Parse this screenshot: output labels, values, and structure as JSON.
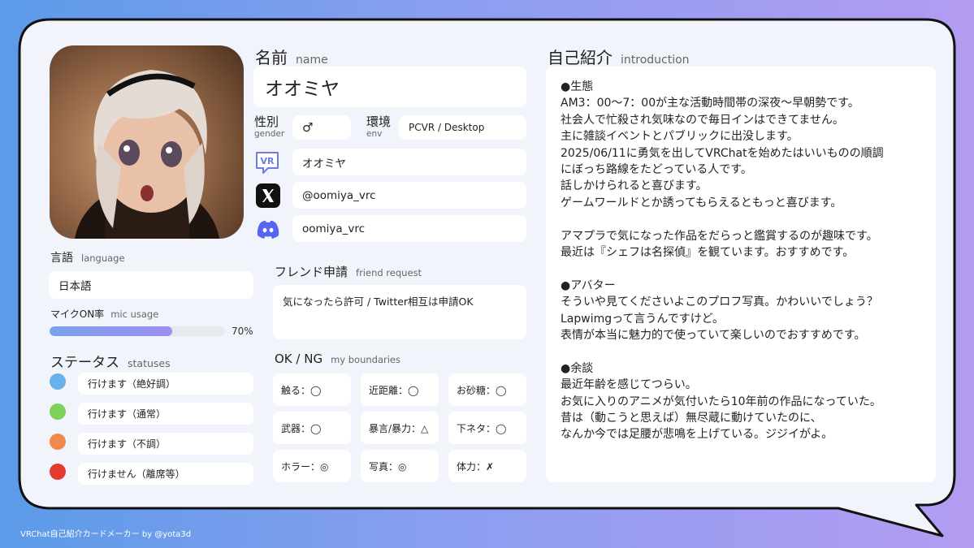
{
  "colors": {
    "background_start": "#5b9be8",
    "background_end": "#b39cf2",
    "card": "#f1f4fb",
    "field": "#ffffff",
    "status_great": "#6ab0ea",
    "status_normal": "#7ed15b",
    "status_poor": "#f08a4b",
    "status_unavailable": "#e33b2d",
    "mic_bar": "#8f9ff0"
  },
  "avatar": {
    "icon": "avatar-photo"
  },
  "name": {
    "label": "名前",
    "sub": "name",
    "value": "オオミヤ"
  },
  "gender": {
    "label": "性別",
    "sub": "gender",
    "value": "♂"
  },
  "env": {
    "label": "環境",
    "sub": "env",
    "value": "PCVR / Desktop"
  },
  "sns": {
    "vrchat": {
      "icon": "vrchat-icon",
      "icon_text": "VR",
      "value": "オオミヤ"
    },
    "x": {
      "icon": "x-icon",
      "icon_text": "𝕏",
      "value": "@oomiya_vrc"
    },
    "discord": {
      "icon": "discord-icon",
      "value": "oomiya_vrc"
    }
  },
  "language": {
    "label": "言語",
    "sub": "language",
    "value": "日本語"
  },
  "mic": {
    "label": "マイクON率",
    "sub": "mic usage",
    "percent": 70,
    "percent_text": "70%"
  },
  "statuses": {
    "label": "ステータス",
    "sub": "statuses",
    "items": [
      {
        "text": "行けます（絶好調）",
        "color": "#6ab0ea"
      },
      {
        "text": "行けます（通常）",
        "color": "#7ed15b"
      },
      {
        "text": "行けます（不調）",
        "color": "#f08a4b"
      },
      {
        "text": "行けません（離席等）",
        "color": "#e33b2d"
      }
    ]
  },
  "friend_request": {
    "label": "フレンド申請",
    "sub": "friend request",
    "value": "気になったら許可 / Twitter相互は申請OK"
  },
  "boundaries": {
    "label": "OK / NG",
    "sub": "my boundaries",
    "items": [
      "触る：◯",
      "近距離：◯",
      "お砂糖：◯",
      "武器：◯",
      "暴言/暴力：△",
      "下ネタ：◯",
      "ホラー：◎",
      "写真：◎",
      "体力：✗"
    ]
  },
  "introduction": {
    "label": "自己紹介",
    "sub": "introduction",
    "lines": [
      "●生態",
      "AM3：00〜7：00が主な活動時間帯の深夜〜早朝勢です。",
      "社会人で忙殺され気味なので毎日インはできてません。",
      "主に雑談イベントとパブリックに出没します。",
      "2025/06/11に勇気を出してVRChatを始めたはいいものの順調",
      "にぼっち路線をたどっている人です。",
      "話しかけられると喜びます。",
      "ゲームワールドとか誘ってもらえるともっと喜びます。",
      "",
      "アマプラで気になった作品をだらっと鑑賞するのが趣味です。",
      "最近は『シェフは名探偵』を観ています。おすすめです。",
      "",
      "●アバター",
      "そういや見てくださいよこのプロフ写真。かわいいでしょう？",
      "Lapwimgって言うんですけど。",
      "表情が本当に魅力的で使っていて楽しいのでおすすめです。",
      "",
      "●余談",
      "最近年齢を感じてつらい。",
      "お気に入りのアニメが気付いたら10年前の作品になっていた。",
      "昔は（動こうと思えば）無尽蔵に動けていたのに、",
      "なんか今では足腰が悲鳴を上げている。ジジイがよ。"
    ]
  },
  "footer": "VRChat自己紹介カードメーカー by @yota3d"
}
